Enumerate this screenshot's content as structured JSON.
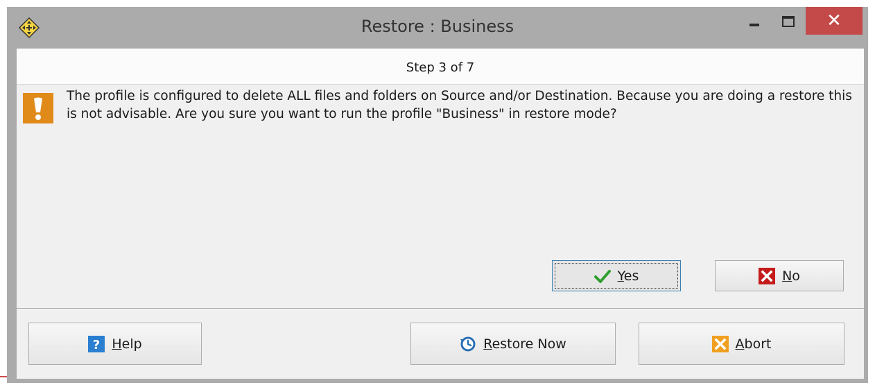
{
  "window": {
    "title": "Restore : Business",
    "app_icon": "move-cross-icon",
    "controls": {
      "minimize_icon": "minimize-icon",
      "maximize_icon": "maximize-icon",
      "close_label": "✕"
    }
  },
  "wizard": {
    "step_text": "Step 3 of 7"
  },
  "dialog": {
    "warning_icon": "exclamation-warning-icon",
    "message": "The profile is configured to delete ALL files and folders on Source and/or Destination. Because you are doing a restore this is not advisable. Are you sure you want to run the profile \"Business\" in restore mode?",
    "yes": {
      "mnemonic": "Y",
      "rest": "es",
      "icon": "checkmark-icon"
    },
    "no": {
      "mnemonic": "N",
      "rest": "o",
      "icon": "red-x-icon"
    }
  },
  "footer": {
    "help": {
      "mnemonic": "H",
      "rest": "elp",
      "icon": "help-question-icon"
    },
    "restore_now": {
      "mnemonic": "R",
      "rest": "estore Now",
      "icon": "clock-restore-icon"
    },
    "abort": {
      "mnemonic": "A",
      "rest": "bort",
      "icon": "orange-x-icon"
    }
  },
  "colors": {
    "close_button": "#c44a4a",
    "warning": "#e08a1a",
    "yes_border": "#3c7fb1",
    "titlebar": "#ababab"
  }
}
